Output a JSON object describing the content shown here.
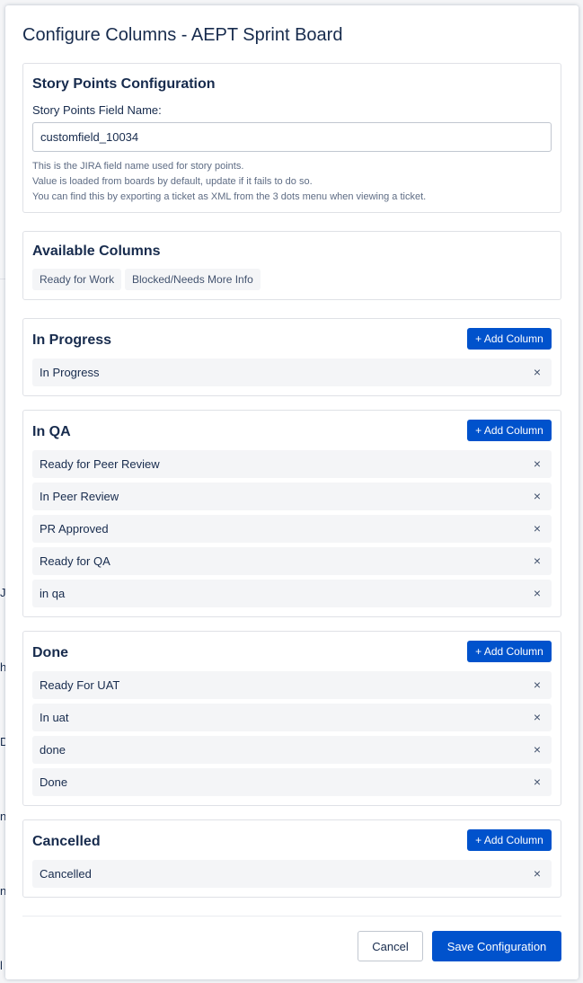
{
  "modal": {
    "title": "Configure Columns - AEPT Sprint Board"
  },
  "story_points": {
    "heading": "Story Points Configuration",
    "field_label": "Story Points Field Name:",
    "field_value": "customfield_10034",
    "help_lines": [
      "This is the JIRA field name used for story points.",
      "Value is loaded from boards by default, update if it fails to do so.",
      "You can find this by exporting a ticket as XML from the 3 dots menu when viewing a ticket."
    ]
  },
  "available": {
    "heading": "Available Columns",
    "chips": [
      "Ready for Work",
      "Blocked/Needs More Info"
    ]
  },
  "add_column_label": "+ Add Column",
  "remove_symbol": "×",
  "groups": [
    {
      "name": "In Progress",
      "columns": [
        "In Progress"
      ]
    },
    {
      "name": "In QA",
      "columns": [
        "Ready for Peer Review",
        "In Peer Review",
        "PR Approved",
        "Ready for QA",
        "in qa"
      ]
    },
    {
      "name": "Done",
      "columns": [
        "Ready For UAT",
        "In uat",
        "done",
        "Done"
      ]
    },
    {
      "name": "Cancelled",
      "columns": [
        "Cancelled"
      ]
    }
  ],
  "footer": {
    "cancel_label": "Cancel",
    "save_label": "Save Configuration"
  },
  "background": {
    "edge_chars": [
      "Je",
      "h",
      "D",
      "n",
      "n",
      "l"
    ]
  },
  "colors": {
    "primary": "#0052cc",
    "text": "#172b4d",
    "row_bg": "#f4f5f7",
    "border": "#dfe1e6"
  }
}
